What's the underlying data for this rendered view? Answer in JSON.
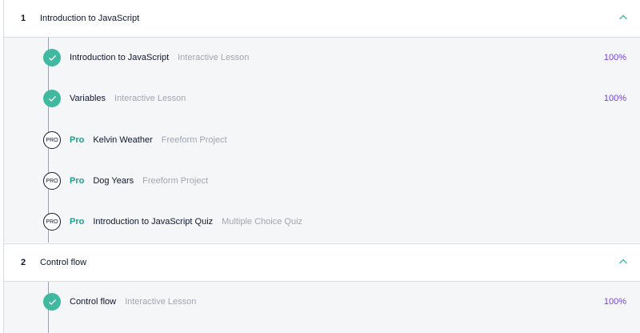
{
  "colors": {
    "accent_teal": "#41b8a0",
    "pro_green": "#1b9e8a",
    "progress_purple": "#6f43e6",
    "muted_text": "#a1a5b0"
  },
  "sections": [
    {
      "number": "1",
      "title": "Introduction to JavaScript",
      "chevron_icon": "chevron-up-icon",
      "items": [
        {
          "status": "completed",
          "status_icon": "check-icon",
          "pro_label": "",
          "title": "Introduction to JavaScript",
          "type": "Interactive Lesson",
          "progress": "100%"
        },
        {
          "status": "completed",
          "status_icon": "check-icon",
          "pro_label": "",
          "title": "Variables",
          "type": "Interactive Lesson",
          "progress": "100%"
        },
        {
          "status": "pro",
          "status_icon": "pro-badge-icon",
          "badge_text": "PRO",
          "pro_label": "Pro",
          "title": "Kelvin Weather",
          "type": "Freeform Project",
          "progress": ""
        },
        {
          "status": "pro",
          "status_icon": "pro-badge-icon",
          "badge_text": "PRO",
          "pro_label": "Pro",
          "title": "Dog Years",
          "type": "Freeform Project",
          "progress": ""
        },
        {
          "status": "pro",
          "status_icon": "pro-badge-icon",
          "badge_text": "PRO",
          "pro_label": "Pro",
          "title": "Introduction to JavaScript Quiz",
          "type": "Multiple Choice Quiz",
          "progress": ""
        }
      ]
    },
    {
      "number": "2",
      "title": "Control flow",
      "chevron_icon": "chevron-up-icon",
      "items": [
        {
          "status": "completed",
          "status_icon": "check-icon",
          "pro_label": "",
          "title": "Control flow",
          "type": "Interactive Lesson",
          "progress": "100%"
        }
      ]
    }
  ]
}
